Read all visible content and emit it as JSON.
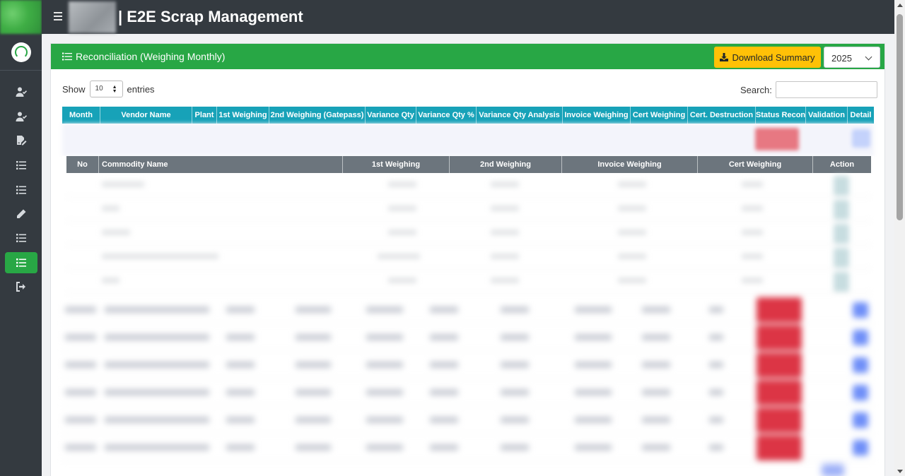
{
  "app": {
    "title": "| E2E Scrap Management"
  },
  "sidebar": {
    "items": [
      {
        "icon": "user-check-icon"
      },
      {
        "icon": "user-check-icon"
      },
      {
        "icon": "file-signature-icon"
      },
      {
        "icon": "list-icon"
      },
      {
        "icon": "list-icon"
      },
      {
        "icon": "pencil-icon"
      },
      {
        "icon": "list-icon"
      },
      {
        "icon": "list-icon",
        "active": true
      },
      {
        "icon": "sign-out-icon"
      }
    ]
  },
  "card": {
    "title": "Reconciliation (Weighing Monthly)",
    "download_label": "Download Summary",
    "year": "2025",
    "header_color": "#28a745"
  },
  "table_controls": {
    "show_label": "Show",
    "page_length": "10",
    "entries_label": "entries",
    "search_label": "Search:",
    "search_value": ""
  },
  "main_table": {
    "columns": [
      "Month",
      "Vendor Name",
      "Plant",
      "1st Weighing",
      "2nd Weighing (Gatepass)",
      "Variance Qty",
      "Variance Qty %",
      "Variance Qty Analysis",
      "Invoice Weighing",
      "Cert Weighing",
      "Cert. Destruction",
      "Status Recon",
      "Validation",
      "Detail"
    ],
    "header_color": "#17a2b8"
  },
  "sub_table": {
    "columns": [
      "No",
      "Commodity Name",
      "1st Weighing",
      "2nd Weighing",
      "Invoice Weighing",
      "Cert Weighing",
      "Action"
    ],
    "header_color": "#6c757d"
  }
}
